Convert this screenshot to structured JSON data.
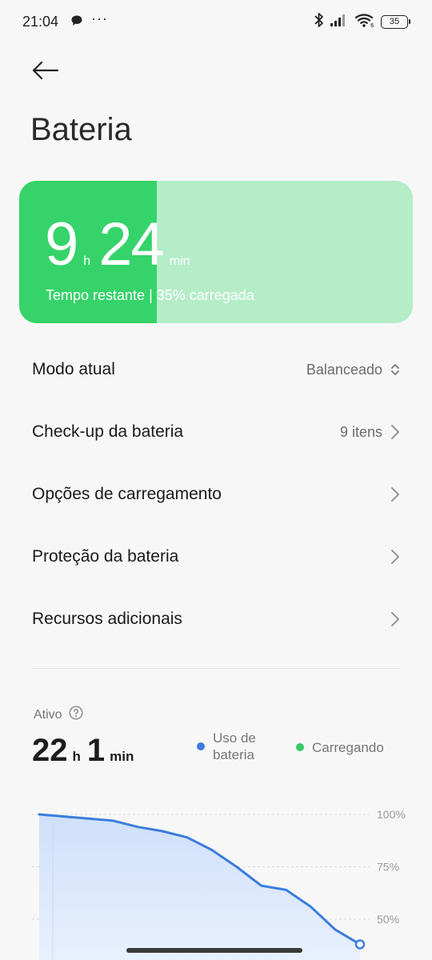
{
  "status_bar": {
    "time": "21:04",
    "dots": "···",
    "battery_level": "35"
  },
  "header": {
    "title": "Bateria"
  },
  "battery_card": {
    "hours": "9",
    "hours_unit": "h",
    "minutes": "24",
    "minutes_unit": "min",
    "subtitle": "Tempo restante | 35% carregada",
    "charge_fraction": 0.35,
    "fill_color": "#35d36a",
    "bg_color": "#b4edc8"
  },
  "settings": [
    {
      "label": "Modo atual",
      "value": "Balanceado",
      "icon": "updown-chevron-icon"
    },
    {
      "label": "Check-up da bateria",
      "value": "9 itens",
      "icon": "chevron-right-icon"
    },
    {
      "label": "Opções de carregamento",
      "value": "",
      "icon": "chevron-right-icon"
    },
    {
      "label": "Proteção da bateria",
      "value": "",
      "icon": "chevron-right-icon"
    },
    {
      "label": "Recursos adicionais",
      "value": "",
      "icon": "chevron-right-icon"
    }
  ],
  "usage": {
    "active_label": "Ativo",
    "hours": "22",
    "hours_unit": "h",
    "minutes": "1",
    "minutes_unit": "min",
    "legend": [
      {
        "label": "Uso de\nbateria",
        "color": "#3b7ddd"
      },
      {
        "label": "Carregando",
        "color": "#35c96a"
      }
    ]
  },
  "chart_data": {
    "type": "area",
    "y_ticks": [
      "100%",
      "75%",
      "50%"
    ],
    "ylim": [
      40,
      100
    ],
    "series": [
      {
        "name": "Uso de bateria",
        "values": [
          100,
          99,
          98,
          97,
          94,
          92,
          89,
          83,
          75,
          66,
          64,
          56,
          45,
          38
        ]
      }
    ]
  }
}
